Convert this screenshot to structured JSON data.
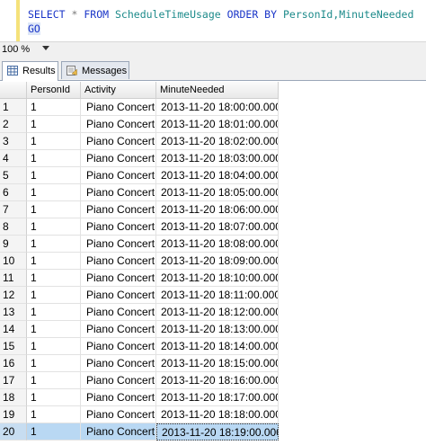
{
  "editor": {
    "line1": {
      "select": "SELECT",
      "star": "*",
      "from": "FROM",
      "table": "ScheduleTimeUsage",
      "order_by": "ORDER BY",
      "columns": "PersonId,MinuteNeeded"
    },
    "line2": "GO"
  },
  "zoom": {
    "value": "100 %"
  },
  "tabs": {
    "results": "Results",
    "messages": "Messages"
  },
  "grid": {
    "columns": [
      "PersonId",
      "Activity",
      "MinuteNeeded"
    ],
    "rows": [
      {
        "n": "1",
        "pid": "1",
        "act": "Piano Concert",
        "min": "2013-11-20 18:00:00.000"
      },
      {
        "n": "2",
        "pid": "1",
        "act": "Piano Concert",
        "min": "2013-11-20 18:01:00.000"
      },
      {
        "n": "3",
        "pid": "1",
        "act": "Piano Concert",
        "min": "2013-11-20 18:02:00.000"
      },
      {
        "n": "4",
        "pid": "1",
        "act": "Piano Concert",
        "min": "2013-11-20 18:03:00.000"
      },
      {
        "n": "5",
        "pid": "1",
        "act": "Piano Concert",
        "min": "2013-11-20 18:04:00.000"
      },
      {
        "n": "6",
        "pid": "1",
        "act": "Piano Concert",
        "min": "2013-11-20 18:05:00.000"
      },
      {
        "n": "7",
        "pid": "1",
        "act": "Piano Concert",
        "min": "2013-11-20 18:06:00.000"
      },
      {
        "n": "8",
        "pid": "1",
        "act": "Piano Concert",
        "min": "2013-11-20 18:07:00.000"
      },
      {
        "n": "9",
        "pid": "1",
        "act": "Piano Concert",
        "min": "2013-11-20 18:08:00.000"
      },
      {
        "n": "10",
        "pid": "1",
        "act": "Piano Concert",
        "min": "2013-11-20 18:09:00.000"
      },
      {
        "n": "11",
        "pid": "1",
        "act": "Piano Concert",
        "min": "2013-11-20 18:10:00.000"
      },
      {
        "n": "12",
        "pid": "1",
        "act": "Piano Concert",
        "min": "2013-11-20 18:11:00.000"
      },
      {
        "n": "13",
        "pid": "1",
        "act": "Piano Concert",
        "min": "2013-11-20 18:12:00.000"
      },
      {
        "n": "14",
        "pid": "1",
        "act": "Piano Concert",
        "min": "2013-11-20 18:13:00.000"
      },
      {
        "n": "15",
        "pid": "1",
        "act": "Piano Concert",
        "min": "2013-11-20 18:14:00.000"
      },
      {
        "n": "16",
        "pid": "1",
        "act": "Piano Concert",
        "min": "2013-11-20 18:15:00.000"
      },
      {
        "n": "17",
        "pid": "1",
        "act": "Piano Concert",
        "min": "2013-11-20 18:16:00.000"
      },
      {
        "n": "18",
        "pid": "1",
        "act": "Piano Concert",
        "min": "2013-11-20 18:17:00.000"
      },
      {
        "n": "19",
        "pid": "1",
        "act": "Piano Concert",
        "min": "2013-11-20 18:18:00.000"
      },
      {
        "n": "20",
        "pid": "1",
        "act": "Piano Concert",
        "min": "2013-11-20 18:19:00.000"
      }
    ],
    "selected_row": "20"
  }
}
